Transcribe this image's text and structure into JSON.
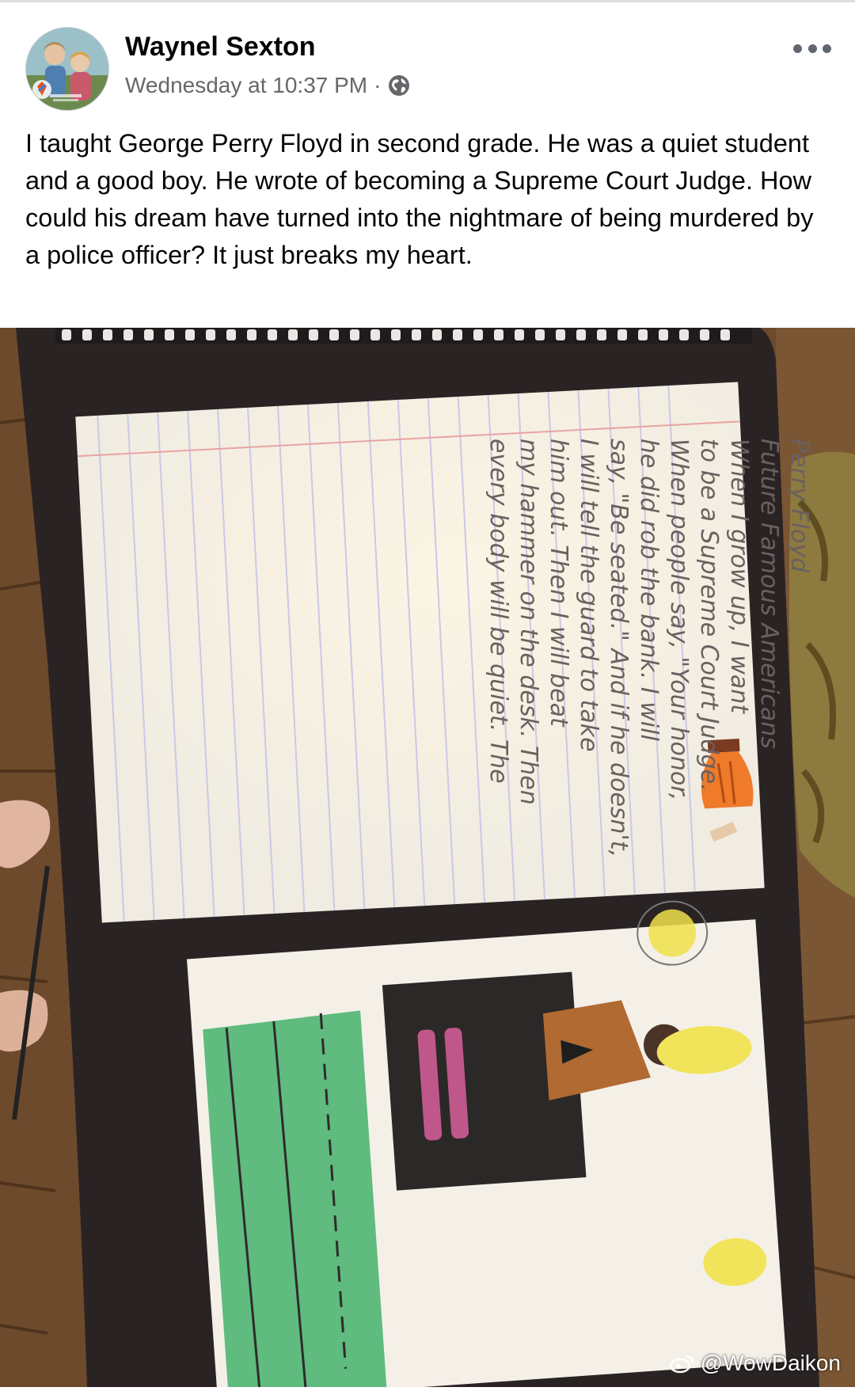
{
  "post": {
    "author": "Waynel Sexton",
    "timestamp": "Wednesday at 10:37 PM",
    "separator": "·",
    "audience_icon": "globe-icon",
    "more_icon": "more-options-icon",
    "text": "I taught George Perry Floyd in second grade.  He was a quiet student and a good boy.  He wrote of becoming a Supreme Court Judge.  How could his dream have turned into the nightmare of being murdered by a police officer?  It just breaks my heart."
  },
  "photo": {
    "handwriting_lines": [
      "Perry Floyd",
      "Future   Famous Americans",
      "When I  grow up, I  want",
      "to be a Supreme Court Judge.",
      "When people say, \"Your honor,",
      "he did rob the bank. I will",
      "say, \"Be seated.\" And if he doesn't,",
      "I will tell the guard to take",
      "him out. Then I will beat",
      "my hammer on the desk. Then",
      "every body will be quiet. The"
    ],
    "watermark": "@WowDaikon"
  },
  "colors": {
    "author": "#050505",
    "meta": "#65676b",
    "notebook_cover": "#2a2324",
    "paper": "#f1ece1",
    "pencil": "#6a6060"
  }
}
